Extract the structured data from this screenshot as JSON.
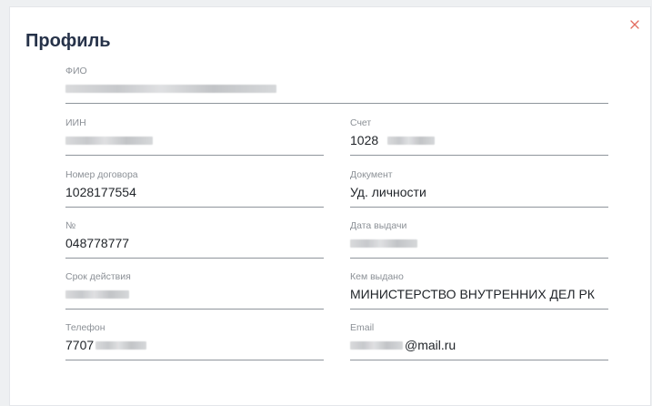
{
  "modal": {
    "title": "Профиль"
  },
  "fields": {
    "fio": {
      "label": "ФИО",
      "value": ""
    },
    "iin": {
      "label": "ИИН",
      "value": ""
    },
    "account": {
      "label": "Счет",
      "value": "1028"
    },
    "contract": {
      "label": "Номер договора",
      "value": "1028177554"
    },
    "document": {
      "label": "Документ",
      "value": "Уд. личности"
    },
    "number": {
      "label": "№",
      "value": "048778777"
    },
    "issue_date": {
      "label": "Дата выдачи",
      "value": ""
    },
    "validity": {
      "label": "Срок действия",
      "value": ""
    },
    "issued_by": {
      "label": "Кем выдано",
      "value": "МИНИСТЕРСТВО ВНУТРЕННИХ ДЕЛ РК"
    },
    "phone": {
      "label": "Телефон",
      "value": "7707"
    },
    "email": {
      "label": "Email",
      "value": "@mail.ru"
    }
  },
  "icons": {
    "close": "close-icon"
  },
  "colors": {
    "close": "#e26b5f",
    "title": "#263249",
    "underline": "#8f959c"
  }
}
